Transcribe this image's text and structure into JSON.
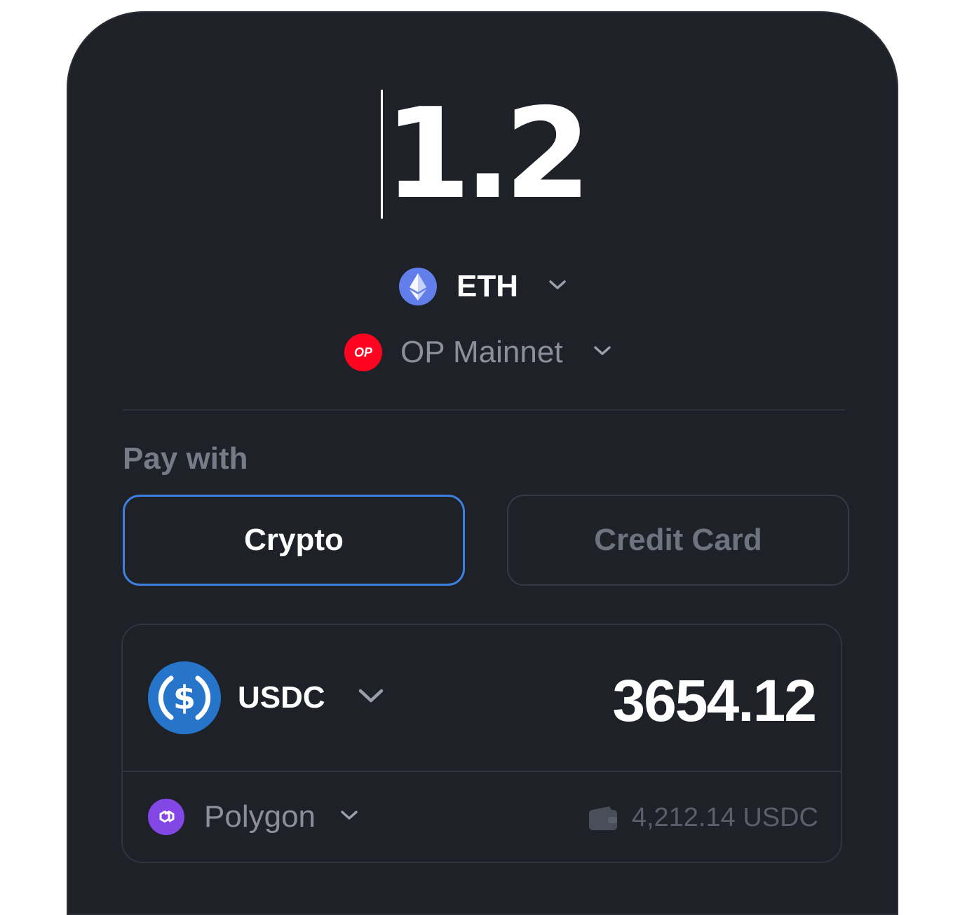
{
  "amount": {
    "value": "1.2"
  },
  "token": {
    "symbol": "ETH",
    "icon": "ethereum-icon"
  },
  "network": {
    "name": "OP Mainnet",
    "icon": "optimism-icon",
    "badge_text": "OP"
  },
  "payment": {
    "label": "Pay with",
    "tabs": [
      {
        "label": "Crypto",
        "selected": true
      },
      {
        "label": "Credit Card",
        "selected": false
      }
    ]
  },
  "pay_token": {
    "symbol": "USDC",
    "icon": "usdc-icon",
    "amount": "3654.12",
    "network": "Polygon",
    "network_icon": "polygon-icon",
    "balance": "4,212.14 USDC",
    "balance_icon": "wallet-icon"
  },
  "colors": {
    "background": "#1f2128",
    "accent": "#3f7fe0",
    "eth": "#627eea",
    "op": "#ff0420",
    "usdc": "#2775ca",
    "polygon": "#8247e5"
  }
}
